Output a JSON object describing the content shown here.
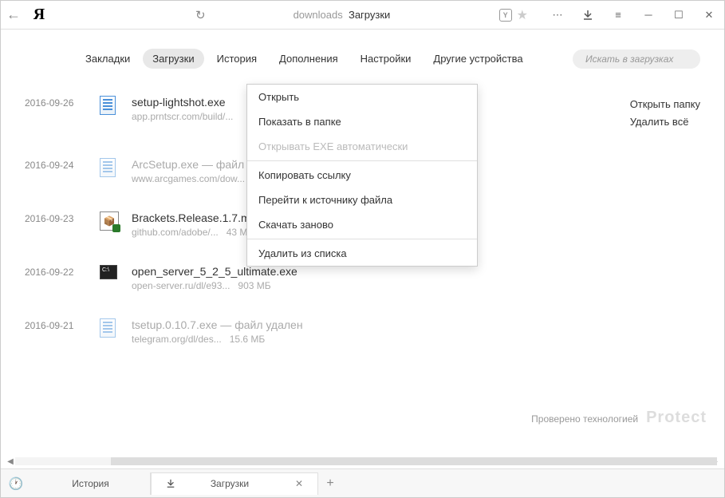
{
  "titlebar": {
    "address_prefix": "downloads",
    "address_title": "Загрузки"
  },
  "tabs": {
    "items": [
      "Закладки",
      "Загрузки",
      "История",
      "Дополнения",
      "Настройки",
      "Другие устройства"
    ],
    "search_placeholder": "Искать в загрузках"
  },
  "actions": {
    "open_folder": "Открыть папку",
    "delete_all": "Удалить всё"
  },
  "downloads": [
    {
      "date": "2016-09-26",
      "name": "setup-lightshot.exe",
      "deleted": false,
      "source": "app.prntscr.com/build/...",
      "size": "",
      "icon": "file"
    },
    {
      "date": "2016-09-24",
      "name": "ArcSetup.exe — файл удален",
      "deleted": true,
      "source": "www.arcgames.com/dow...",
      "size": "",
      "icon": "file"
    },
    {
      "date": "2016-09-23",
      "name": "Brackets.Release.1.7.msi",
      "deleted": false,
      "source": "github.com/adobe/...",
      "size": "43 МБ",
      "icon": "msi"
    },
    {
      "date": "2016-09-22",
      "name": "open_server_5_2_5_ultimate.exe",
      "deleted": false,
      "source": "open-server.ru/dl/e93...",
      "size": "903 МБ",
      "icon": "cmd"
    },
    {
      "date": "2016-09-21",
      "name": "tsetup.0.10.7.exe — файл удален",
      "deleted": true,
      "source": "telegram.org/dl/des...",
      "size": "15.6 МБ",
      "icon": "file"
    }
  ],
  "context_menu": {
    "open": "Открыть",
    "show_in_folder": "Показать в папке",
    "auto_open": "Открывать EXE автоматически",
    "copy_link": "Копировать ссылку",
    "goto_source": "Перейти к источнику файла",
    "redownload": "Скачать заново",
    "remove": "Удалить из списка"
  },
  "footer": {
    "protect_text": "Проверено технологией",
    "protect_brand": "Protect"
  },
  "bottom_tabs": {
    "history": "История",
    "downloads": "Загрузки"
  }
}
